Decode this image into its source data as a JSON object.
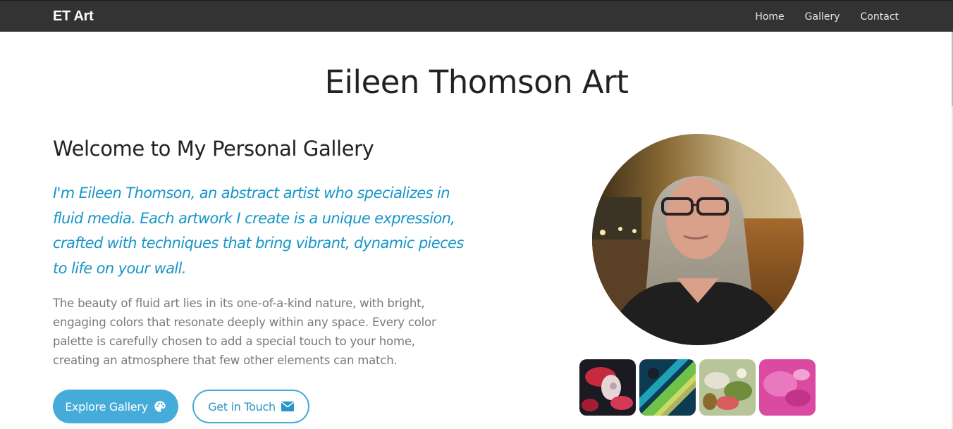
{
  "nav": {
    "brand": "ET Art",
    "links": [
      "Home",
      "Gallery",
      "Contact"
    ]
  },
  "hero": {
    "title": "Eileen Thomson Art",
    "welcome": "Welcome to My Personal Gallery",
    "lead": "I'm Eileen Thomson, an abstract artist who specializes in fluid media. Each artwork I create is a unique expression, crafted with techniques that bring vibrant, dynamic pieces to life on your wall.",
    "body": "The beauty of fluid art lies in its one-of-a-kind nature, with bright, engaging colors that resonate deeply within any space. Every color palette is carefully chosen to add a special touch to your home, creating an atmosphere that few other elements can match.",
    "buttons": {
      "explore": "Explore Gallery",
      "contact": "Get in Touch"
    }
  },
  "icons": {
    "explore": "palette-icon",
    "contact": "envelope-icon"
  },
  "colors": {
    "navbar": "#333333",
    "accent": "#45acd9",
    "lead_text": "#1695c8",
    "body_text": "#7a7a7a"
  }
}
